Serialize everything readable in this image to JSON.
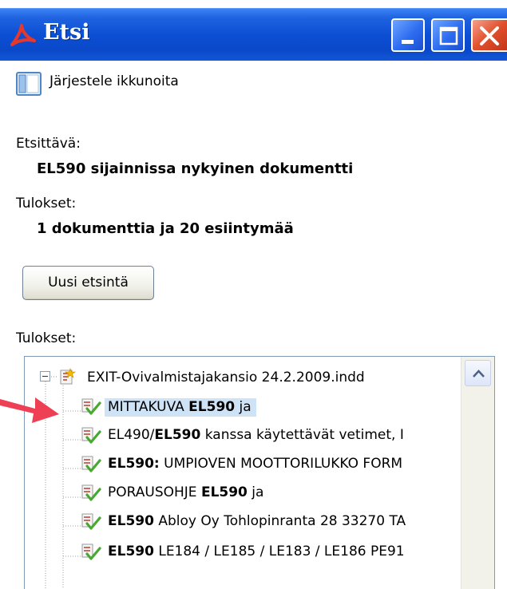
{
  "window": {
    "title": "Etsi",
    "minimize_label": "Minimize",
    "maximize_label": "Maximize",
    "close_label": "Close"
  },
  "arrange": {
    "label": "Järjestele ikkunoita"
  },
  "search_info": {
    "searched_label": "Etsittävä:",
    "searched_value": "EL590 sijainnissa nykyinen dokumentti",
    "results_label": "Tulokset:",
    "results_value": "1 dokumenttia ja 20 esiintymää"
  },
  "new_search_button": "Uusi etsintä",
  "results_list": {
    "label": "Tulokset:",
    "document": "EXIT-Ovivalmistajakansio 24.2.2009.indd",
    "items": [
      {
        "before": "MITTAKUVA ",
        "bold": "EL590",
        "after": " ja",
        "selected": true
      },
      {
        "before": "EL490/",
        "bold": "EL590",
        "after": " kanssa käytettävät vetimet, I",
        "selected": false
      },
      {
        "before": "",
        "bold": "EL590:",
        "after": " UMPIOVEN MOOTTORILUKKO FORM",
        "selected": false
      },
      {
        "before": "PORAUSOHJE ",
        "bold": "EL590",
        "after": " ja",
        "selected": false
      },
      {
        "before": "",
        "bold": "EL590",
        "after": " Abloy Oy Tohlopinranta 28 33270 TA",
        "selected": false
      },
      {
        "before": "",
        "bold": "EL590",
        "after": " LE184 / LE185 / LE183 / LE186 PE91",
        "selected": false
      }
    ]
  },
  "colors": {
    "titlebar": "#0c4fd4",
    "selection": "#cfe3f7",
    "annotation_arrow": "#ee3f55"
  }
}
